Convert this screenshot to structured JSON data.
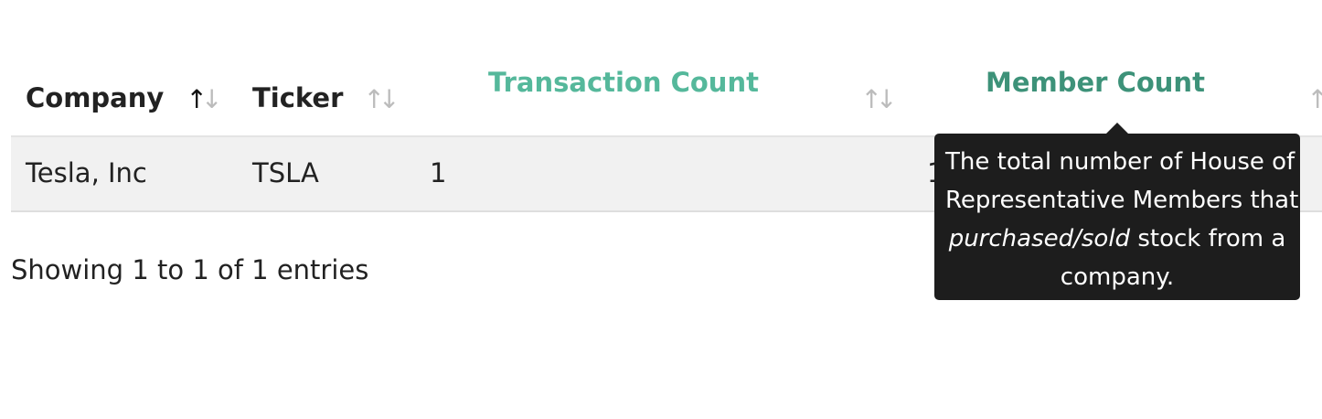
{
  "table": {
    "columns": [
      {
        "label": "Company",
        "sort": "ascending"
      },
      {
        "label": "Ticker",
        "sort": "none"
      },
      {
        "label": "Transaction Count",
        "sort": "none"
      },
      {
        "label": "Member Count",
        "sort": "none"
      }
    ],
    "rows": [
      {
        "company": "Tesla, Inc",
        "ticker": "TSLA",
        "transaction_count": "1",
        "member_count": "1"
      }
    ],
    "info": "Showing 1 to 1 of 1 entries"
  },
  "tooltip": {
    "line_1": "The total number of House of",
    "line_2": "Representative Members that",
    "line_3_emphasis": "purchased/sold",
    "line_3_rest": " stock from a",
    "line_4": "company."
  },
  "icons": {
    "sort_up": "↑",
    "sort_down": "↓"
  },
  "colors": {
    "transaction_count_header": "#55b89b",
    "member_count_header": "#3d9279",
    "active_sort_icon": "#111111",
    "inactive_sort_icon": "#bcbcbc",
    "tooltip_background": "#1d1d1d"
  }
}
